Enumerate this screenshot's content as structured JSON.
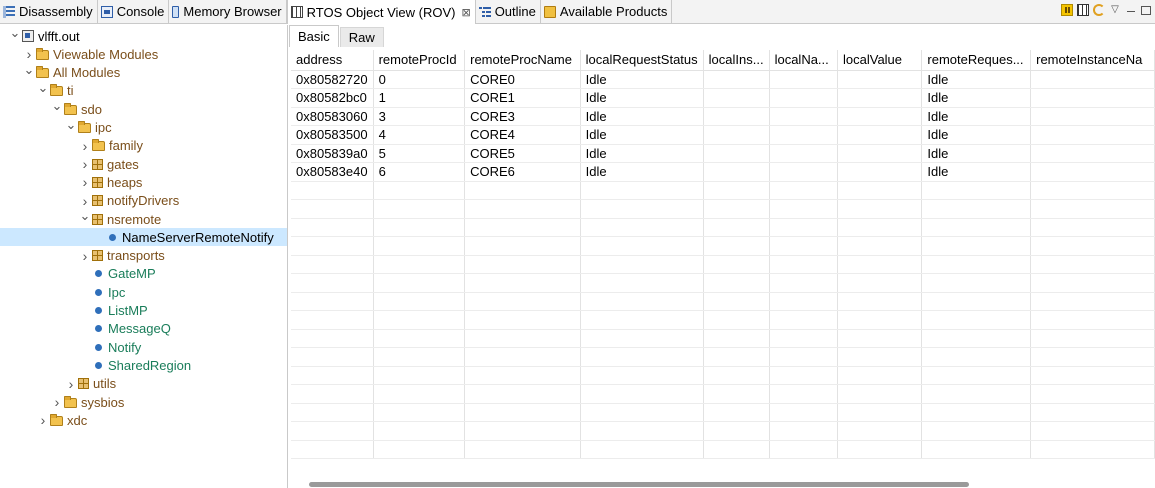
{
  "view_tabs": [
    {
      "label": "Disassembly",
      "icon": "disassembly-icon",
      "active": false
    },
    {
      "label": "Console",
      "icon": "console-icon",
      "active": false
    },
    {
      "label": "Memory Browser",
      "icon": "memory-icon",
      "active": false
    },
    {
      "label": "RTOS Object View (ROV)",
      "icon": "rov-icon",
      "active": true,
      "close": "⊠"
    },
    {
      "label": "Outline",
      "icon": "outline-icon",
      "active": false
    },
    {
      "label": "Available Products",
      "icon": "products-icon",
      "active": false
    }
  ],
  "toolbar_icons": [
    "pause-icon",
    "table-icon",
    "refresh-icon",
    "view-menu-icon",
    "minimize-icon",
    "maximize-icon"
  ],
  "tree": [
    {
      "label": "vlfft.out",
      "depth": 0,
      "twisty": "expanded",
      "icon": "project-icon",
      "color": "black"
    },
    {
      "label": "Viewable Modules",
      "depth": 1,
      "twisty": "collapsed",
      "icon": "folder-icon",
      "color": "brown"
    },
    {
      "label": "All Modules",
      "depth": 1,
      "twisty": "expanded",
      "icon": "folder-icon",
      "color": "brown"
    },
    {
      "label": "ti",
      "depth": 2,
      "twisty": "expanded",
      "icon": "folder-icon",
      "color": "brown"
    },
    {
      "label": "sdo",
      "depth": 3,
      "twisty": "expanded",
      "icon": "folder-icon",
      "color": "brown"
    },
    {
      "label": "ipc",
      "depth": 4,
      "twisty": "expanded",
      "icon": "folder-icon",
      "color": "brown"
    },
    {
      "label": "family",
      "depth": 5,
      "twisty": "collapsed",
      "icon": "folder-icon",
      "color": "brown"
    },
    {
      "label": "gates",
      "depth": 5,
      "twisty": "collapsed",
      "icon": "package-icon",
      "color": "brown"
    },
    {
      "label": "heaps",
      "depth": 5,
      "twisty": "collapsed",
      "icon": "package-icon",
      "color": "brown"
    },
    {
      "label": "notifyDrivers",
      "depth": 5,
      "twisty": "collapsed",
      "icon": "package-icon",
      "color": "brown"
    },
    {
      "label": "nsremote",
      "depth": 5,
      "twisty": "expanded",
      "icon": "package-icon",
      "color": "brown"
    },
    {
      "label": "NameServerRemoteNotify",
      "depth": 6,
      "twisty": "none",
      "icon": "module-icon",
      "color": "black",
      "selected": true
    },
    {
      "label": "transports",
      "depth": 5,
      "twisty": "collapsed",
      "icon": "package-icon",
      "color": "brown"
    },
    {
      "label": "GateMP",
      "depth": 5,
      "twisty": "none",
      "icon": "module-icon",
      "color": "green"
    },
    {
      "label": "Ipc",
      "depth": 5,
      "twisty": "none",
      "icon": "module-icon",
      "color": "green"
    },
    {
      "label": "ListMP",
      "depth": 5,
      "twisty": "none",
      "icon": "module-icon",
      "color": "green"
    },
    {
      "label": "MessageQ",
      "depth": 5,
      "twisty": "none",
      "icon": "module-icon",
      "color": "green"
    },
    {
      "label": "Notify",
      "depth": 5,
      "twisty": "none",
      "icon": "module-icon",
      "color": "green"
    },
    {
      "label": "SharedRegion",
      "depth": 5,
      "twisty": "none",
      "icon": "module-icon",
      "color": "green"
    },
    {
      "label": "utils",
      "depth": 4,
      "twisty": "collapsed",
      "icon": "package-icon",
      "color": "brown"
    },
    {
      "label": "sysbios",
      "depth": 3,
      "twisty": "collapsed",
      "icon": "folder-icon",
      "color": "brown"
    },
    {
      "label": "xdc",
      "depth": 2,
      "twisty": "collapsed",
      "icon": "folder-icon",
      "color": "brown"
    }
  ],
  "sub_tabs": [
    {
      "label": "Basic",
      "active": true
    },
    {
      "label": "Raw",
      "active": false
    }
  ],
  "table": {
    "columns": [
      "address",
      "remoteProcId",
      "remoteProcName",
      "localRequestStatus",
      "localIns...",
      "localNa...",
      "localValue",
      "remoteReques...",
      "remoteInstanceNa"
    ],
    "rows": [
      [
        "0x80582720",
        "0",
        "CORE0",
        "Idle",
        "",
        "",
        "",
        "Idle",
        ""
      ],
      [
        "0x80582bc0",
        "1",
        "CORE1",
        "Idle",
        "",
        "",
        "",
        "Idle",
        ""
      ],
      [
        "0x80583060",
        "3",
        "CORE3",
        "Idle",
        "",
        "",
        "",
        "Idle",
        ""
      ],
      [
        "0x80583500",
        "4",
        "CORE4",
        "Idle",
        "",
        "",
        "",
        "Idle",
        ""
      ],
      [
        "0x805839a0",
        "5",
        "CORE5",
        "Idle",
        "",
        "",
        "",
        "Idle",
        ""
      ],
      [
        "0x80583e40",
        "6",
        "CORE6",
        "Idle",
        "",
        "",
        "",
        "Idle",
        ""
      ]
    ],
    "empty_rows": 15
  },
  "colors": {
    "selection": "#cce8ff",
    "folder_label": "#7a4e1a",
    "module_label": "#1a7d5a",
    "module_dot": "#2f6fba"
  }
}
